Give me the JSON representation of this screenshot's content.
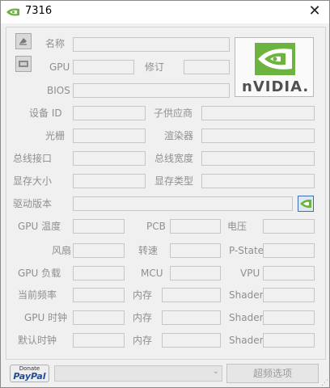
{
  "window": {
    "title": "7316",
    "close_glyph": "✕"
  },
  "labels": {
    "name": "名称",
    "gpu": "GPU",
    "revision": "修订",
    "bios": "BIOS",
    "device_id": "设备 ID",
    "subvendor": "子供应商",
    "rops": "光栅",
    "shaders": "渲染器",
    "bus_interface": "总线接口",
    "bus_width": "总线宽度",
    "mem_size": "显存大小",
    "mem_type": "显存类型",
    "driver_version": "驱动版本",
    "gpu_temp": "GPU 温度",
    "pcb": "PCB",
    "voltage": "电压",
    "fan": "风扇",
    "rpm": "转速",
    "pstate": "P-State",
    "gpu_load": "GPU 负载",
    "mcu": "MCU",
    "vpu": "VPU",
    "cur_clock": "当前频率",
    "gpu_clock": "GPU 时钟",
    "default_clock": "默认时钟",
    "memory": "内存",
    "shader": "Shader"
  },
  "logo": {
    "brand": "nVIDIA."
  },
  "bottom": {
    "donate_top": "Donate",
    "donate_brand": "PayPal",
    "combo_arrow": "⌄",
    "overclock_label": "超频选项",
    "grip": "⋰"
  },
  "colors": {
    "accent_green": "#6db33f",
    "panel_bg": "#f0f0f0",
    "label_gray": "#8f8f8f"
  }
}
